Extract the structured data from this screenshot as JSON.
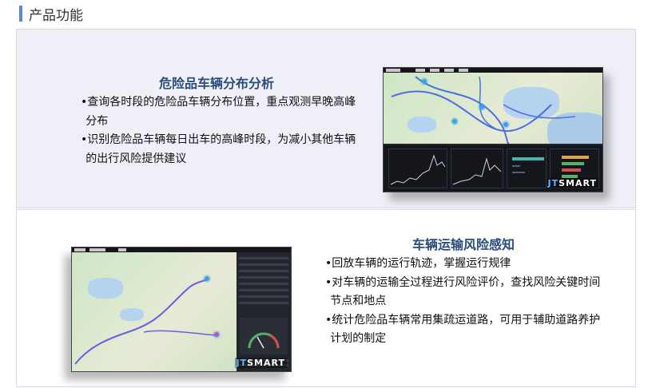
{
  "section": {
    "title": "产品功能",
    "accent_color": "#5b86c9"
  },
  "features": [
    {
      "title": "危险品车辆分布分析",
      "items": [
        "•查询各时段的危险品车辆分布位置，重点观测早晚高峰分布",
        "•识别危险品车辆每日出车的高峰时段，为减小其他车辆的出行风险提供建议"
      ],
      "logo_prefix": "JT",
      "logo_suffix": "SMART"
    },
    {
      "title": "车辆运输风险感知",
      "items": [
        "•回放车辆的运行轨迹，掌握运行规律",
        "•对车辆的运输全过程进行风险评价，查找风险关键时间节点和地点",
        "•统计危险品车辆常用集疏运道路，可用于辅助道路养护计划的制定"
      ],
      "logo_prefix": "JT",
      "logo_suffix": "SMART"
    }
  ]
}
